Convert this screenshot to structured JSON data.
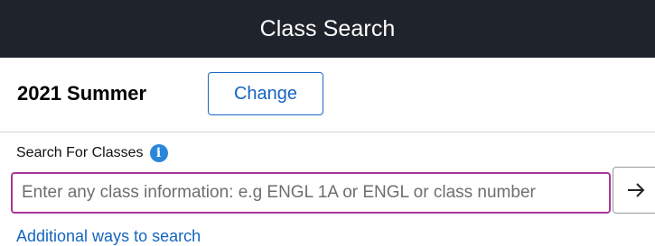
{
  "header": {
    "title": "Class Search"
  },
  "term": {
    "label": "2021 Summer",
    "change_button": "Change"
  },
  "search": {
    "label": "Search For Classes",
    "info_icon": "info-icon",
    "placeholder": "Enter any class information: e.g ENGL 1A or ENGL or class number",
    "value": "",
    "submit_icon": "arrow-right-icon"
  },
  "links": {
    "additional_ways": "Additional ways to search"
  },
  "colors": {
    "header_bg": "#1f232b",
    "accent_blue": "#1565c0",
    "input_focus_border": "#a9379a",
    "info_icon_bg": "#2a86d9"
  }
}
